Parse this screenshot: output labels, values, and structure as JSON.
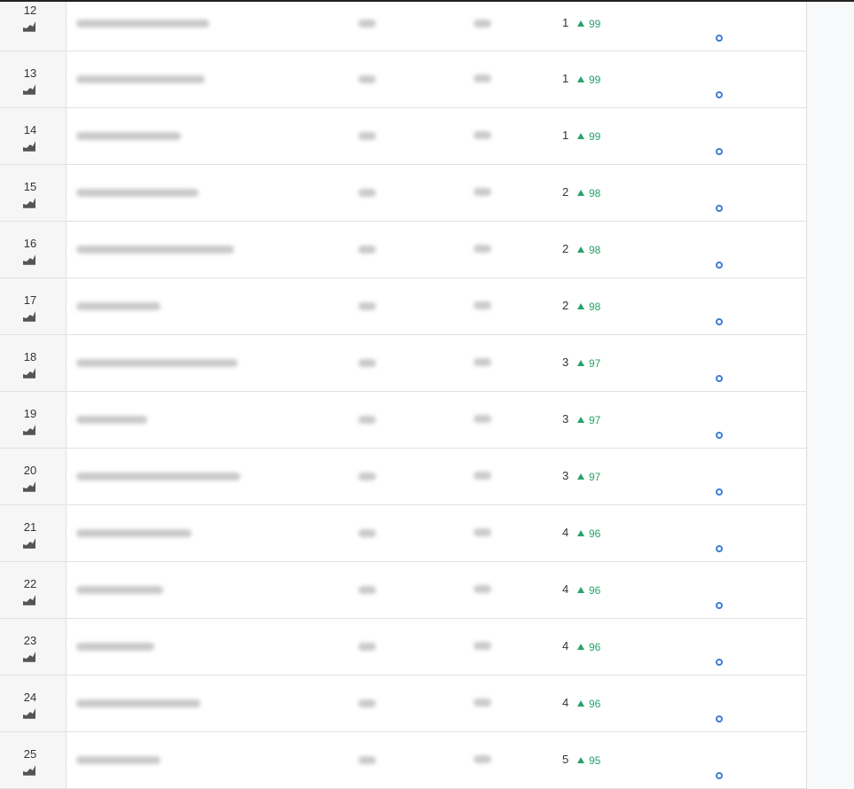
{
  "icon": "chart-area-icon",
  "colors": {
    "trend_up": "#27a36a",
    "dot": "#3b7dd8"
  },
  "rows": [
    {
      "index": "12",
      "position": "1",
      "change": "99"
    },
    {
      "index": "13",
      "position": "1",
      "change": "99"
    },
    {
      "index": "14",
      "position": "1",
      "change": "99"
    },
    {
      "index": "15",
      "position": "2",
      "change": "98"
    },
    {
      "index": "16",
      "position": "2",
      "change": "98"
    },
    {
      "index": "17",
      "position": "2",
      "change": "98"
    },
    {
      "index": "18",
      "position": "3",
      "change": "97"
    },
    {
      "index": "19",
      "position": "3",
      "change": "97"
    },
    {
      "index": "20",
      "position": "3",
      "change": "97"
    },
    {
      "index": "21",
      "position": "4",
      "change": "96"
    },
    {
      "index": "22",
      "position": "4",
      "change": "96"
    },
    {
      "index": "23",
      "position": "4",
      "change": "96"
    },
    {
      "index": "24",
      "position": "4",
      "change": "96"
    },
    {
      "index": "25",
      "position": "5",
      "change": "95"
    }
  ]
}
